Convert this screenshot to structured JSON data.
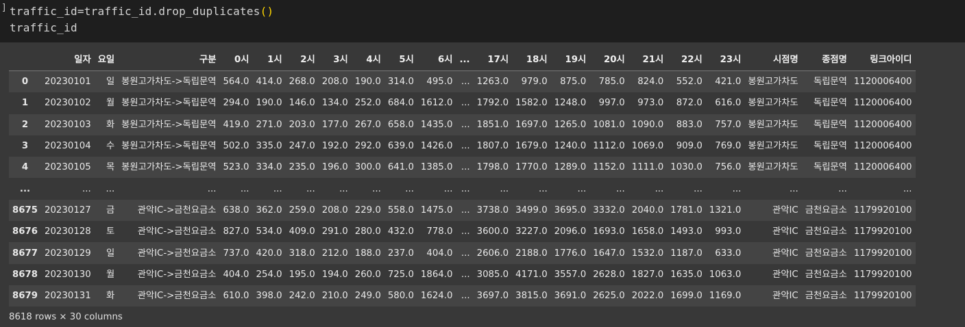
{
  "code": {
    "prompt_bracket": "]",
    "line1_text": "traffic_id=traffic_id.drop_duplicates",
    "line1_parens": "()",
    "line2_text": "traffic_id"
  },
  "table": {
    "columns": [
      "",
      "일자",
      "요일",
      "구분",
      "0시",
      "1시",
      "2시",
      "3시",
      "4시",
      "5시",
      "6시",
      "...",
      "17시",
      "18시",
      "19시",
      "20시",
      "21시",
      "22시",
      "23시",
      "시점명",
      "종점명",
      "링크아이디"
    ],
    "rows": [
      [
        "0",
        "20230101",
        "일",
        "봉원고가차도->독립문역",
        "564.0",
        "414.0",
        "268.0",
        "208.0",
        "190.0",
        "314.0",
        "495.0",
        "...",
        "1263.0",
        "979.0",
        "875.0",
        "785.0",
        "824.0",
        "552.0",
        "421.0",
        "봉원고가차도",
        "독립문역",
        "1120006400"
      ],
      [
        "1",
        "20230102",
        "월",
        "봉원고가차도->독립문역",
        "294.0",
        "190.0",
        "146.0",
        "134.0",
        "252.0",
        "684.0",
        "1612.0",
        "...",
        "1792.0",
        "1582.0",
        "1248.0",
        "997.0",
        "973.0",
        "872.0",
        "616.0",
        "봉원고가차도",
        "독립문역",
        "1120006400"
      ],
      [
        "2",
        "20230103",
        "화",
        "봉원고가차도->독립문역",
        "419.0",
        "271.0",
        "203.0",
        "177.0",
        "267.0",
        "658.0",
        "1435.0",
        "...",
        "1851.0",
        "1697.0",
        "1265.0",
        "1081.0",
        "1090.0",
        "883.0",
        "757.0",
        "봉원고가차도",
        "독립문역",
        "1120006400"
      ],
      [
        "3",
        "20230104",
        "수",
        "봉원고가차도->독립문역",
        "502.0",
        "335.0",
        "247.0",
        "192.0",
        "292.0",
        "639.0",
        "1426.0",
        "...",
        "1807.0",
        "1679.0",
        "1240.0",
        "1112.0",
        "1069.0",
        "909.0",
        "769.0",
        "봉원고가차도",
        "독립문역",
        "1120006400"
      ],
      [
        "4",
        "20230105",
        "목",
        "봉원고가차도->독립문역",
        "523.0",
        "334.0",
        "235.0",
        "196.0",
        "300.0",
        "641.0",
        "1385.0",
        "...",
        "1798.0",
        "1770.0",
        "1289.0",
        "1152.0",
        "1111.0",
        "1030.0",
        "756.0",
        "봉원고가차도",
        "독립문역",
        "1120006400"
      ],
      [
        "...",
        "...",
        "...",
        "...",
        "...",
        "...",
        "...",
        "...",
        "...",
        "...",
        "...",
        "...",
        "...",
        "...",
        "...",
        "...",
        "...",
        "...",
        "...",
        "...",
        "...",
        "..."
      ],
      [
        "8675",
        "20230127",
        "금",
        "관악IC->금천요금소",
        "638.0",
        "362.0",
        "259.0",
        "208.0",
        "229.0",
        "558.0",
        "1475.0",
        "...",
        "3738.0",
        "3499.0",
        "3695.0",
        "3332.0",
        "2040.0",
        "1781.0",
        "1321.0",
        "관악IC",
        "금천요금소",
        "1179920100"
      ],
      [
        "8676",
        "20230128",
        "토",
        "관악IC->금천요금소",
        "827.0",
        "534.0",
        "409.0",
        "291.0",
        "280.0",
        "432.0",
        "778.0",
        "...",
        "3600.0",
        "3227.0",
        "2096.0",
        "1693.0",
        "1658.0",
        "1493.0",
        "993.0",
        "관악IC",
        "금천요금소",
        "1179920100"
      ],
      [
        "8677",
        "20230129",
        "일",
        "관악IC->금천요금소",
        "737.0",
        "420.0",
        "318.0",
        "212.0",
        "188.0",
        "237.0",
        "404.0",
        "...",
        "2606.0",
        "2188.0",
        "1776.0",
        "1647.0",
        "1532.0",
        "1187.0",
        "633.0",
        "관악IC",
        "금천요금소",
        "1179920100"
      ],
      [
        "8678",
        "20230130",
        "월",
        "관악IC->금천요금소",
        "404.0",
        "254.0",
        "195.0",
        "194.0",
        "260.0",
        "725.0",
        "1864.0",
        "...",
        "3085.0",
        "4171.0",
        "3557.0",
        "2628.0",
        "1827.0",
        "1635.0",
        "1063.0",
        "관악IC",
        "금천요금소",
        "1179920100"
      ],
      [
        "8679",
        "20230131",
        "화",
        "관악IC->금천요금소",
        "610.0",
        "398.0",
        "242.0",
        "210.0",
        "249.0",
        "580.0",
        "1624.0",
        "...",
        "3697.0",
        "3815.0",
        "3691.0",
        "2625.0",
        "2022.0",
        "1699.0",
        "1169.0",
        "관악IC",
        "금천요금소",
        "1179920100"
      ]
    ],
    "footer": "8618 rows × 30 columns"
  }
}
